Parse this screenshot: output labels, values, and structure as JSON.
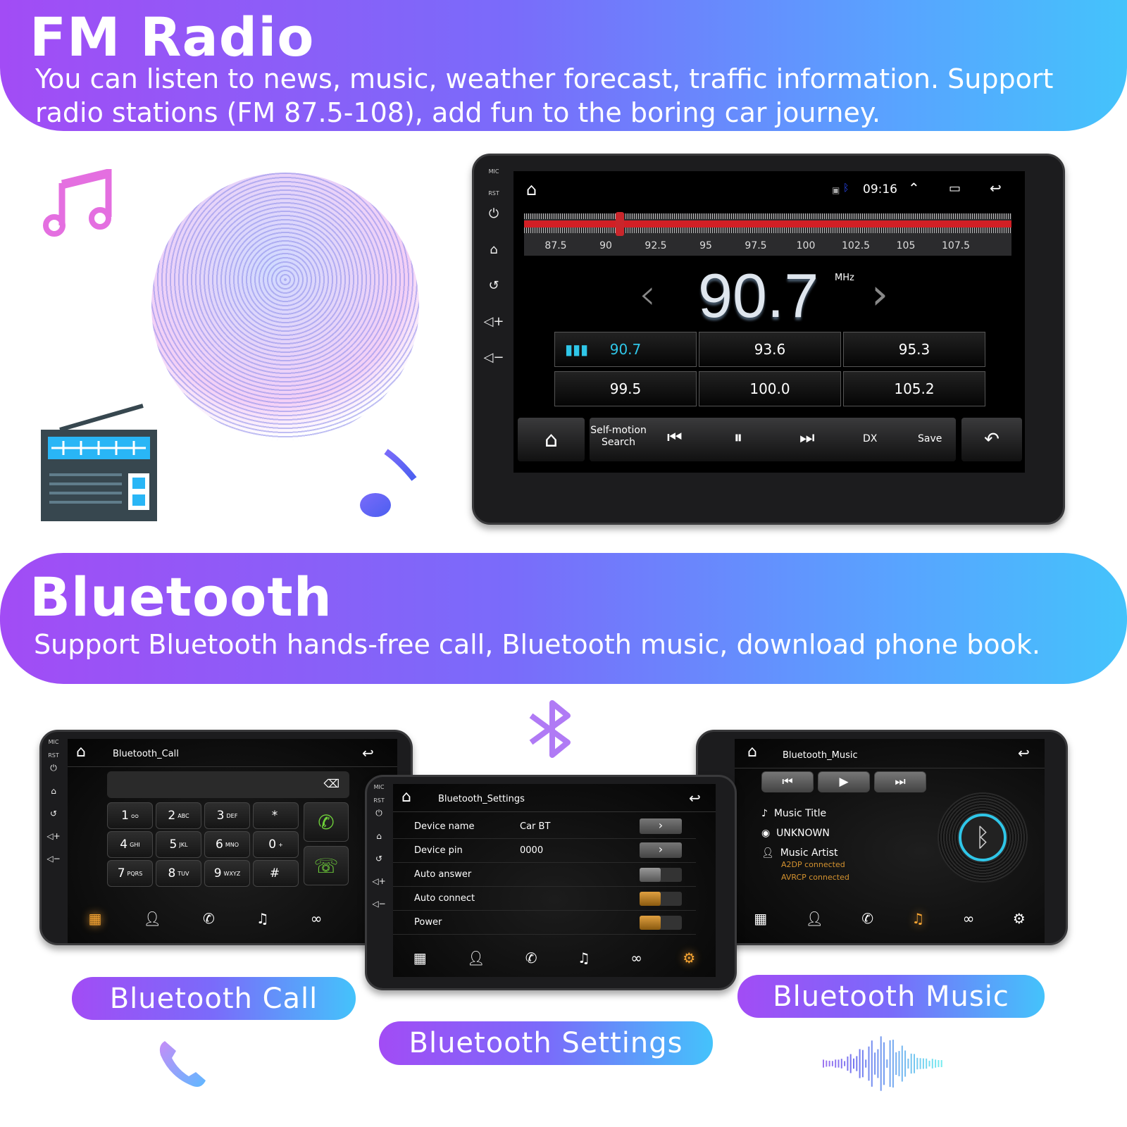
{
  "fm_banner": {
    "title": "FM Radio",
    "subtitle": "You can listen to news, music, weather forecast, traffic information. Support radio stations (FM 87.5-108), add fun to the boring car journey."
  },
  "radio": {
    "side_labels": {
      "mic": "MIC",
      "rst": "RST"
    },
    "time": "09:16",
    "scale_ticks": [
      "87.5",
      "90",
      "92.5",
      "95",
      "97.5",
      "100",
      "102.5",
      "105",
      "107.5"
    ],
    "frequency": "90.7",
    "unit": "MHz",
    "tuner_value_mhz": 90.7,
    "presets": [
      "90.7",
      "93.6",
      "95.3",
      "99.5",
      "100.0",
      "105.2"
    ],
    "active_preset": "90.7",
    "controls": {
      "search": "Self-motion Search",
      "dx": "DX",
      "save": "Save"
    }
  },
  "bt_banner": {
    "title": "Bluetooth",
    "subtitle": "Support Bluetooth hands-free call, Bluetooth music, download phone book."
  },
  "call": {
    "title": "Bluetooth_Call",
    "keys": [
      {
        "d": "1",
        "l": "ᴑᴑ"
      },
      {
        "d": "2",
        "l": "ABC"
      },
      {
        "d": "3",
        "l": "DEF"
      },
      {
        "d": "*",
        "l": ""
      },
      {
        "d": "4",
        "l": "GHI"
      },
      {
        "d": "5",
        "l": "JKL"
      },
      {
        "d": "6",
        "l": "MNO"
      },
      {
        "d": "0",
        "l": "+"
      },
      {
        "d": "7",
        "l": "PQRS"
      },
      {
        "d": "8",
        "l": "TUV"
      },
      {
        "d": "9",
        "l": "WXYZ"
      },
      {
        "d": "#",
        "l": ""
      }
    ]
  },
  "settings": {
    "title": "Bluetooth_Settings",
    "rows": [
      {
        "label": "Device name",
        "value": "Car BT",
        "type": "arrow"
      },
      {
        "label": "Device pin",
        "value": "0000",
        "type": "arrow"
      },
      {
        "label": "Auto answer",
        "value": "",
        "type": "toggle",
        "on": false
      },
      {
        "label": "Auto connect",
        "value": "",
        "type": "toggle",
        "on": true
      },
      {
        "label": "Power",
        "value": "",
        "type": "toggle",
        "on": true
      }
    ]
  },
  "music": {
    "title": "Bluetooth_Music",
    "track_title": "Music Title",
    "album": "UNKNOWN",
    "artist": "Music Artist",
    "a2dp": "A2DP connected",
    "avrcp": "AVRCP connected"
  },
  "labels": {
    "call": "Bluetooth Call",
    "settings": "Bluetooth Settings",
    "music": "Bluetooth Music"
  },
  "colors": {
    "accent_orange": "#f7a533",
    "preset_active": "#2fc6e8",
    "tuner_red": "#d21f25",
    "gradient_start": "#a24cf5",
    "gradient_end": "#44c3fb"
  }
}
